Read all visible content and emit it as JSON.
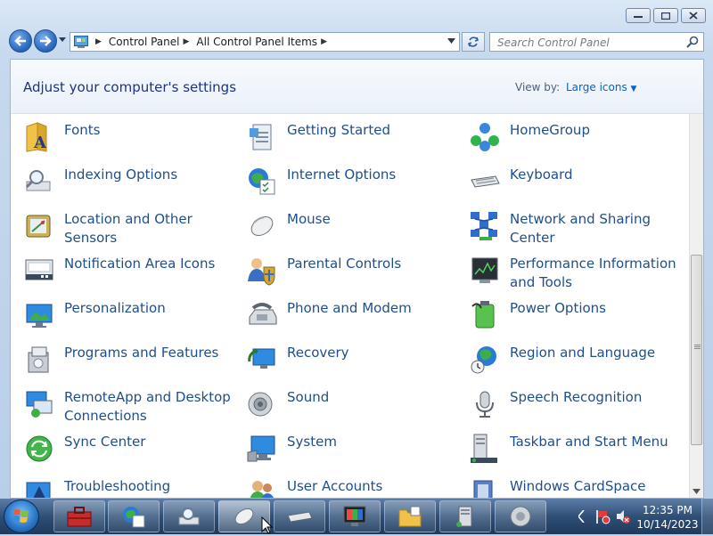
{
  "address": {
    "crumbs": [
      "Control Panel",
      "All Control Panel Items"
    ]
  },
  "search": {
    "placeholder": "Search Control Panel"
  },
  "header": {
    "title": "Adjust your computer's settings",
    "view_by_label": "View by:",
    "view_by_value": "Large icons"
  },
  "items": [
    {
      "label": "Fonts",
      "icon": "fonts-icon"
    },
    {
      "label": "Getting Started",
      "icon": "getting-started-icon"
    },
    {
      "label": "HomeGroup",
      "icon": "homegroup-icon"
    },
    {
      "label": "Indexing Options",
      "icon": "indexing-options-icon"
    },
    {
      "label": "Internet Options",
      "icon": "internet-options-icon"
    },
    {
      "label": "Keyboard",
      "icon": "keyboard-icon"
    },
    {
      "label": "Location and Other Sensors",
      "icon": "location-sensors-icon"
    },
    {
      "label": "Mouse",
      "icon": "mouse-icon"
    },
    {
      "label": "Network and Sharing Center",
      "icon": "network-icon"
    },
    {
      "label": "Notification Area Icons",
      "icon": "notification-area-icon"
    },
    {
      "label": "Parental Controls",
      "icon": "parental-controls-icon"
    },
    {
      "label": "Performance Information and Tools",
      "icon": "performance-icon"
    },
    {
      "label": "Personalization",
      "icon": "personalization-icon"
    },
    {
      "label": "Phone and Modem",
      "icon": "phone-modem-icon"
    },
    {
      "label": "Power Options",
      "icon": "power-options-icon"
    },
    {
      "label": "Programs and Features",
      "icon": "programs-features-icon"
    },
    {
      "label": "Recovery",
      "icon": "recovery-icon"
    },
    {
      "label": "Region and Language",
      "icon": "region-language-icon"
    },
    {
      "label": "RemoteApp and Desktop Connections",
      "icon": "remoteapp-icon"
    },
    {
      "label": "Sound",
      "icon": "sound-icon"
    },
    {
      "label": "Speech Recognition",
      "icon": "speech-recognition-icon"
    },
    {
      "label": "Sync Center",
      "icon": "sync-center-icon"
    },
    {
      "label": "System",
      "icon": "system-icon"
    },
    {
      "label": "Taskbar and Start Menu",
      "icon": "taskbar-start-menu-icon"
    },
    {
      "label": "Troubleshooting",
      "icon": "troubleshooting-icon"
    },
    {
      "label": "User Accounts",
      "icon": "user-accounts-icon"
    },
    {
      "label": "Windows CardSpace",
      "icon": "cardspace-icon"
    }
  ],
  "taskbar": {
    "buttons": [
      "toolbox-icon",
      "internet-options-icon",
      "indexing-options-icon",
      "mouse-icon",
      "keyboard-icon",
      "display-icon",
      "folder-icon",
      "server-icon",
      "sound-icon"
    ],
    "active_button": 3
  },
  "clock": {
    "time": "12:35 PM",
    "date": "10/14/2023"
  },
  "colors": {
    "link": "#1e4f8c",
    "header_title": "#1e3287",
    "accent": "#0066cc"
  }
}
